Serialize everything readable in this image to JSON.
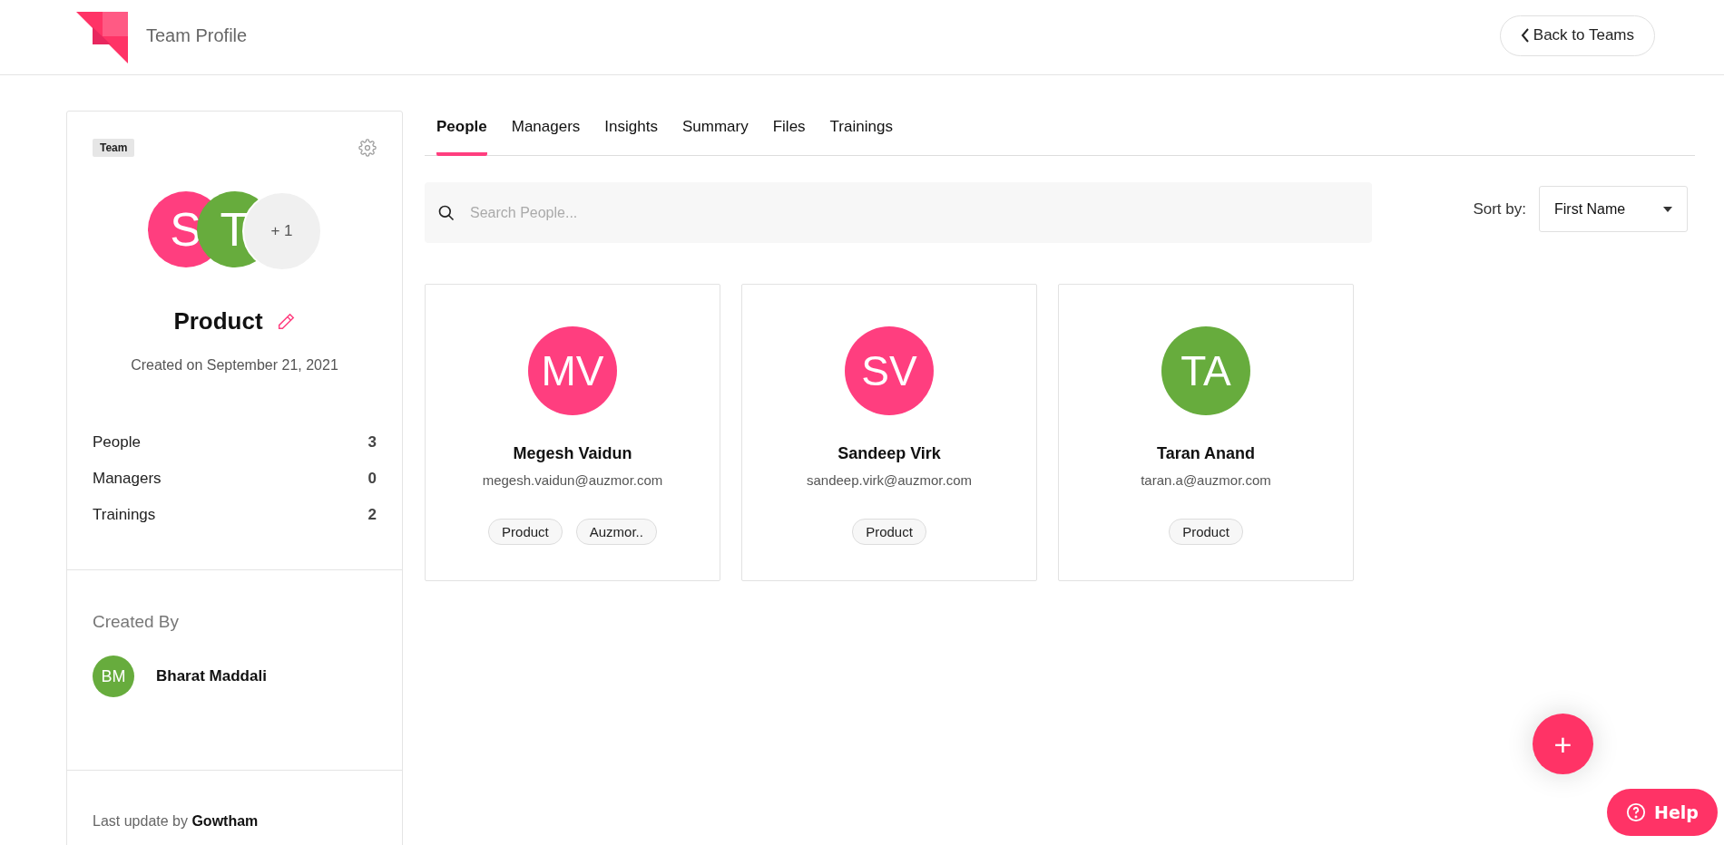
{
  "header": {
    "title": "Team Profile",
    "back_button": "Back to Teams"
  },
  "team": {
    "badge": "Team",
    "avatars": [
      {
        "initials": "S",
        "color": "#ff3e7f"
      },
      {
        "initials": "T",
        "color": "#67ac3d"
      }
    ],
    "more": "+ 1",
    "name": "Product",
    "created": "Created on September 21, 2021",
    "stats": [
      {
        "label": "People",
        "value": "3"
      },
      {
        "label": "Managers",
        "value": "0"
      },
      {
        "label": "Trainings",
        "value": "2"
      }
    ],
    "created_by_label": "Created By",
    "creator": {
      "initials": "BM",
      "name": "Bharat Maddali",
      "color": "#67ac3d"
    },
    "last_update": "Last update by **Gowtham**"
  },
  "tabs": [
    {
      "label": "People",
      "selected": true
    },
    {
      "label": "Managers",
      "selected": false
    },
    {
      "label": "Insights",
      "selected": false
    },
    {
      "label": "Summary",
      "selected": false
    },
    {
      "label": "Files",
      "selected": false
    },
    {
      "label": "Trainings",
      "selected": false
    }
  ],
  "search": {
    "placeholder": "Search People..."
  },
  "sort": {
    "label": "Sort by:",
    "value": "First Name"
  },
  "people": [
    {
      "initials": "MV",
      "color": "#ff3e7f",
      "name": "Megesh Vaidun",
      "email": "megesh.vaidun@auzmor.com",
      "tags": [
        "Product",
        "Auzmor.."
      ]
    },
    {
      "initials": "SV",
      "color": "#ff3e7f",
      "name": "Sandeep Virk",
      "email": "sandeep.virk@auzmor.com",
      "tags": [
        "Product"
      ]
    },
    {
      "initials": "TA",
      "color": "#67ac3d",
      "name": "Taran Anand",
      "email": "taran.a@auzmor.com",
      "tags": [
        "Product"
      ]
    }
  ],
  "fab": "+",
  "help": "Help"
}
